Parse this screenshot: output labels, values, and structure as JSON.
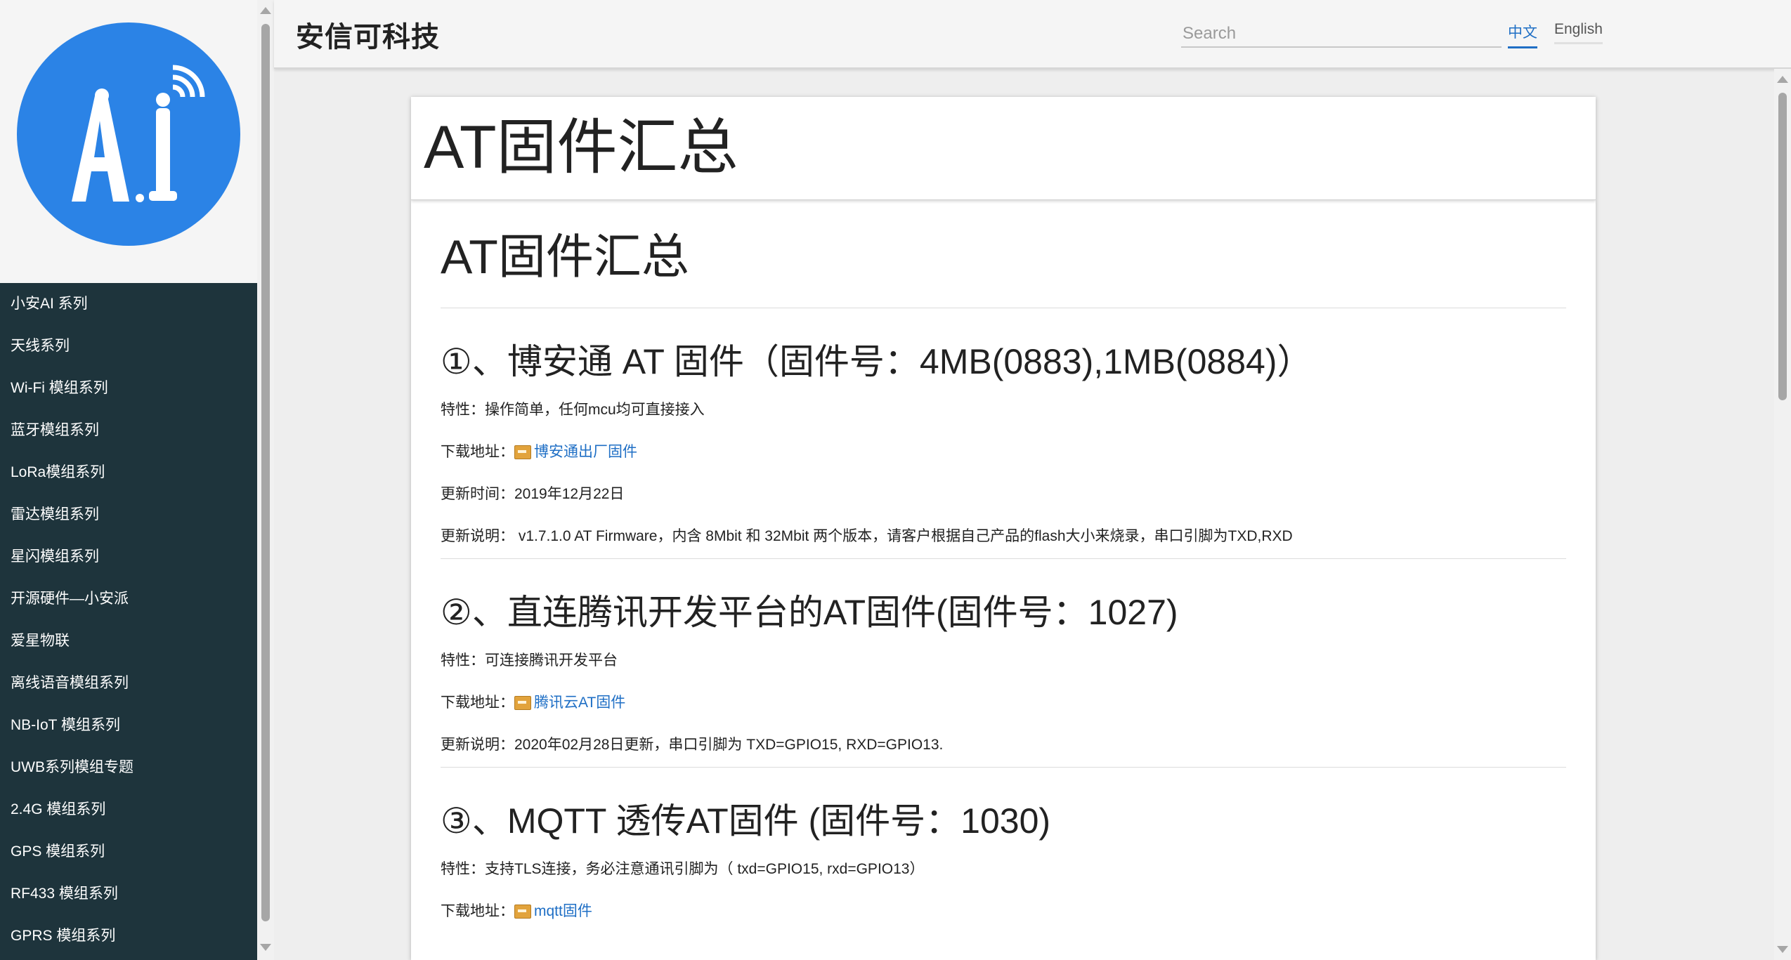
{
  "header": {
    "site_title": "安信可科技",
    "search_placeholder": "Search",
    "lang_zh": "中文",
    "lang_en": "English"
  },
  "logo": {
    "text": "A.I",
    "bg_color": "#2b83e6"
  },
  "sidebar": {
    "items": [
      {
        "label": "小安AI 系列"
      },
      {
        "label": "天线系列"
      },
      {
        "label": "Wi-Fi 模组系列"
      },
      {
        "label": "蓝牙模组系列"
      },
      {
        "label": "LoRa模组系列"
      },
      {
        "label": "雷达模组系列"
      },
      {
        "label": "星闪模组系列"
      },
      {
        "label": "开源硬件—小安派"
      },
      {
        "label": "爱星物联"
      },
      {
        "label": "离线语音模组系列"
      },
      {
        "label": "NB-IoT 模组系列"
      },
      {
        "label": "UWB系列模组专题"
      },
      {
        "label": "2.4G 模组系列"
      },
      {
        "label": "GPS 模组系列"
      },
      {
        "label": "RF433 模组系列"
      },
      {
        "label": "GPRS 模组系列"
      }
    ]
  },
  "card": {
    "title": "AT固件汇总"
  },
  "article": {
    "title": "AT固件汇总",
    "sections": [
      {
        "heading": "①、博安通 AT 固件（固件号：4MB(0883),1MB(0884)）",
        "feature": "特性：操作简单，任何mcu均可直接接入",
        "download_label": "下载地址：",
        "download_link": "博安通出厂固件",
        "update_time": "更新时间：2019年12月22日",
        "update_note": "更新说明：  v1.7.1.0 AT Firmware，内含 8Mbit 和 32Mbit 两个版本，请客户根据自己产品的flash大小来烧录，串口引脚为TXD,RXD"
      },
      {
        "heading": "②、直连腾讯开发平台的AT固件(固件号：1027)",
        "feature": "特性：可连接腾讯开发平台",
        "download_label": "下载地址：",
        "download_link": "腾讯云AT固件",
        "update_note": "更新说明：2020年02月28日更新，串口引脚为 TXD=GPIO15, RXD=GPIO13."
      },
      {
        "heading": "③、MQTT 透传AT固件 (固件号：1030)",
        "feature": "特性：支持TLS连接，务必注意通讯引脚为（ txd=GPIO15, rxd=GPIO13）",
        "download_label": "下载地址：",
        "download_link": "mqtt固件"
      }
    ]
  },
  "colors": {
    "sidebar_bg": "#1e343c",
    "link": "#1f6fc5",
    "accent": "#2b83e6"
  }
}
